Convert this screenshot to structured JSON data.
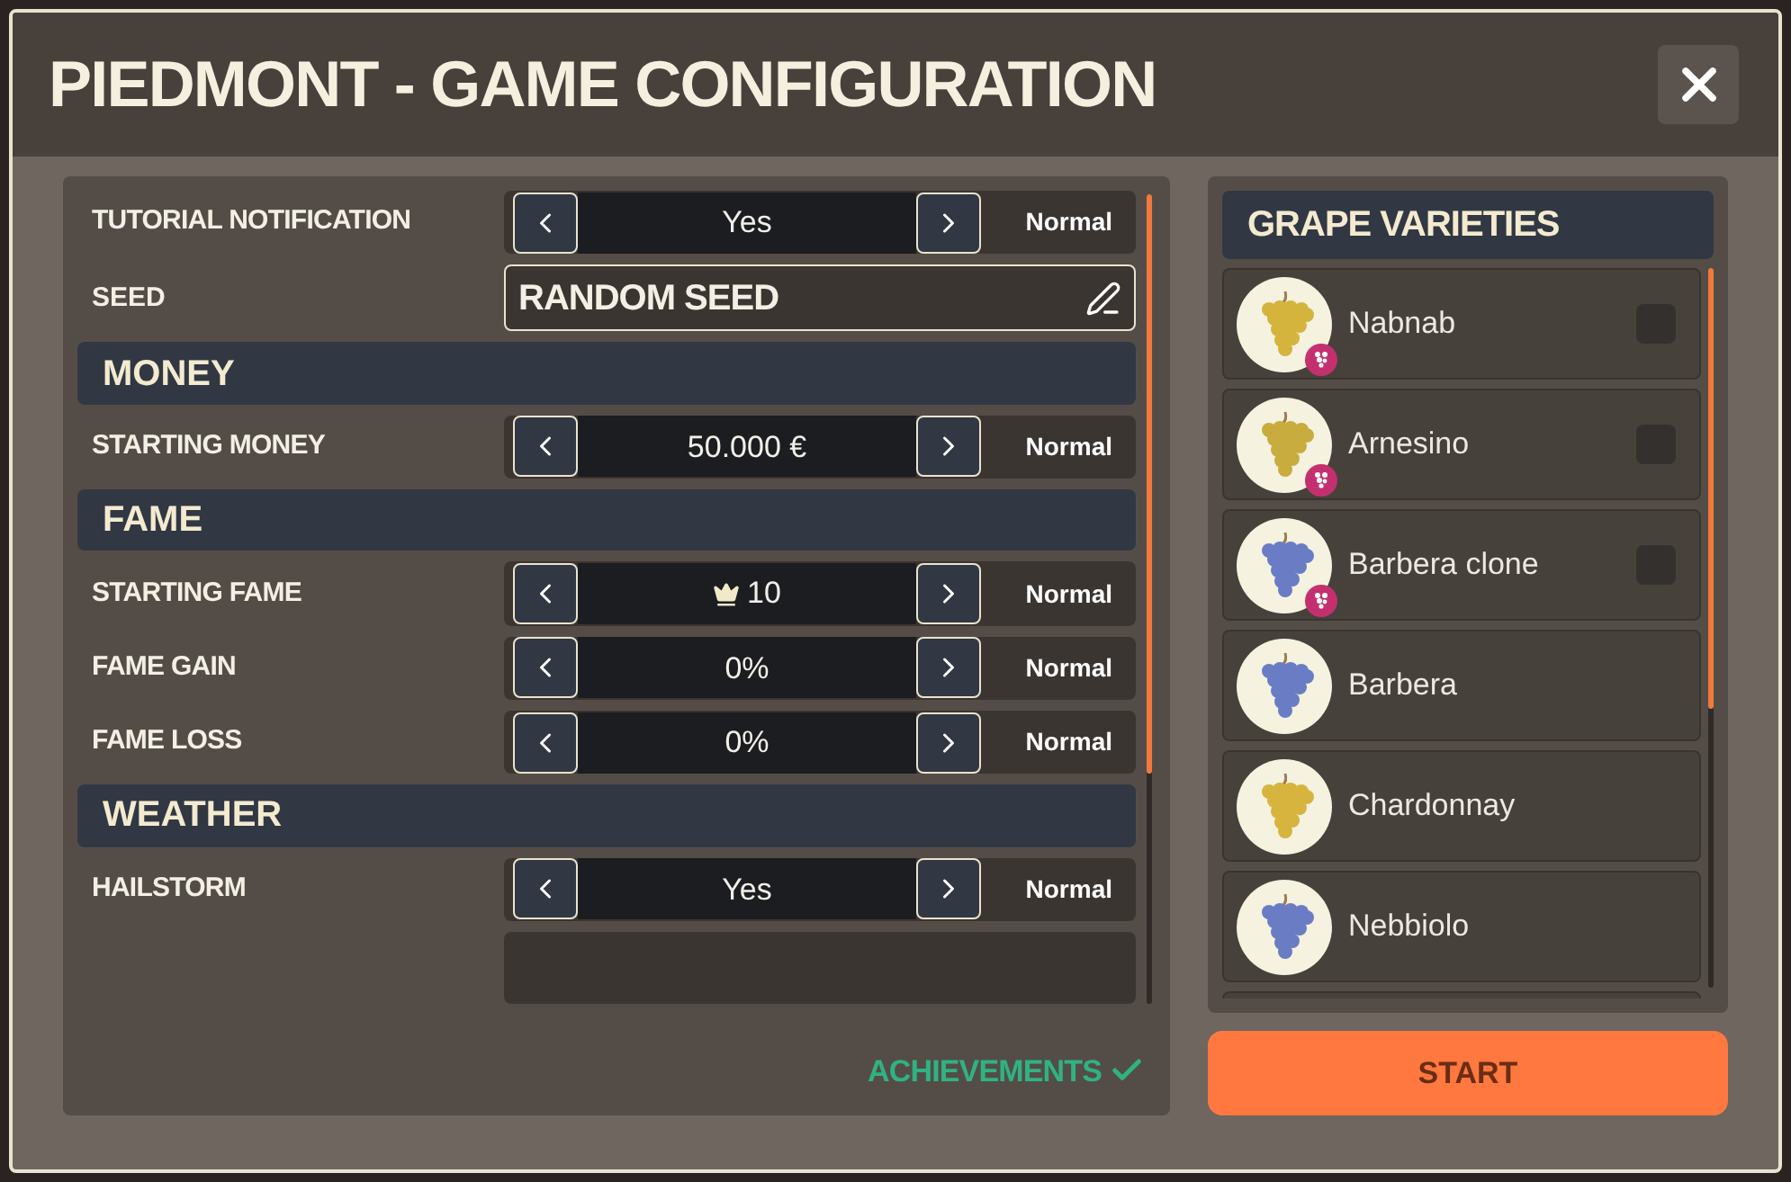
{
  "window": {
    "title": "PIEDMONT - GAME CONFIGURATION"
  },
  "settings": [
    {
      "kind": "stepper",
      "label": "TUTORIAL NOTIFICATION",
      "value": "Yes",
      "mode": "Normal"
    },
    {
      "kind": "seed",
      "label": "SEED",
      "value": "RANDOM SEED"
    },
    {
      "kind": "header",
      "label": "MONEY"
    },
    {
      "kind": "stepper",
      "label": "STARTING MONEY",
      "value": "50.000 €",
      "mode": "Normal"
    },
    {
      "kind": "header",
      "label": "FAME"
    },
    {
      "kind": "stepper",
      "label": "STARTING FAME",
      "value": "10",
      "crown": true,
      "mode": "Normal"
    },
    {
      "kind": "stepper",
      "label": "FAME GAIN",
      "value": "0%",
      "mode": "Normal"
    },
    {
      "kind": "stepper",
      "label": "FAME LOSS",
      "value": "0%",
      "mode": "Normal"
    },
    {
      "kind": "header",
      "label": "WEATHER"
    },
    {
      "kind": "stepper",
      "label": "HAILSTORM",
      "value": "Yes",
      "mode": "Normal"
    }
  ],
  "achievements": {
    "label": "ACHIEVEMENTS",
    "checked": true
  },
  "grapes": {
    "title": "GRAPE VARIETIES",
    "items": [
      {
        "name": "Nabnab",
        "color": "#d4b43c",
        "badge": true,
        "checked": false
      },
      {
        "name": "Arnesino",
        "color": "#c8ac3e",
        "badge": true,
        "checked": false
      },
      {
        "name": "Barbera clone",
        "color": "#6a7cc4",
        "badge": true,
        "checked": false
      },
      {
        "name": "Barbera",
        "color": "#6a7cc4",
        "badge": false
      },
      {
        "name": "Chardonnay",
        "color": "#d6b43e",
        "badge": false
      },
      {
        "name": "Nebbiolo",
        "color": "#6a7cc4",
        "badge": false
      }
    ]
  },
  "start_button": {
    "label": "START"
  }
}
